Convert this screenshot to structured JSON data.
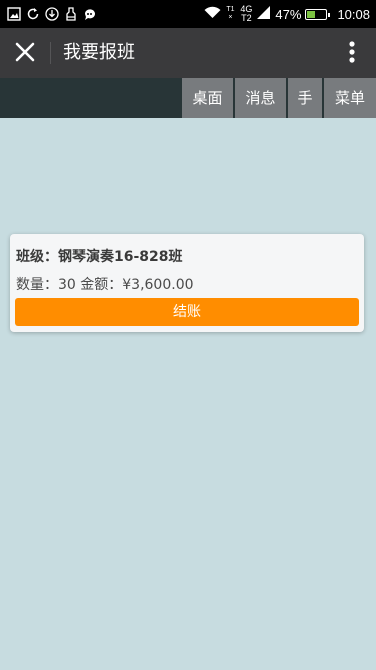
{
  "status_bar": {
    "icons": [
      "image-icon",
      "sync-icon",
      "download-icon",
      "clean-icon",
      "chat-icon"
    ],
    "signal_top": "T1",
    "signal_bottom": "×",
    "network_type": "4G",
    "network_sub": "T2",
    "battery": "47%",
    "battery_level": 0.47,
    "time": "10:08",
    "battery_color": "#7cc242"
  },
  "header": {
    "title": "我要报班",
    "close_icon": "close-icon",
    "menu_icon": "more-vertical-icon"
  },
  "actions": {
    "items": [
      {
        "label": "桌面"
      },
      {
        "label": "消息"
      },
      {
        "label": "手"
      },
      {
        "label": "菜单"
      }
    ]
  },
  "order": {
    "class_label": "班级：钢琴演奏16-828班",
    "quantity_amount": "数量：30 金额：¥3,600.00",
    "checkout_label": "结账",
    "checkout_color": "#ff8d00"
  },
  "colors": {
    "background": "#c7dce0",
    "title_bar": "#3a3a3c",
    "action_strip": "#283537",
    "action_button": "#787b7e"
  }
}
